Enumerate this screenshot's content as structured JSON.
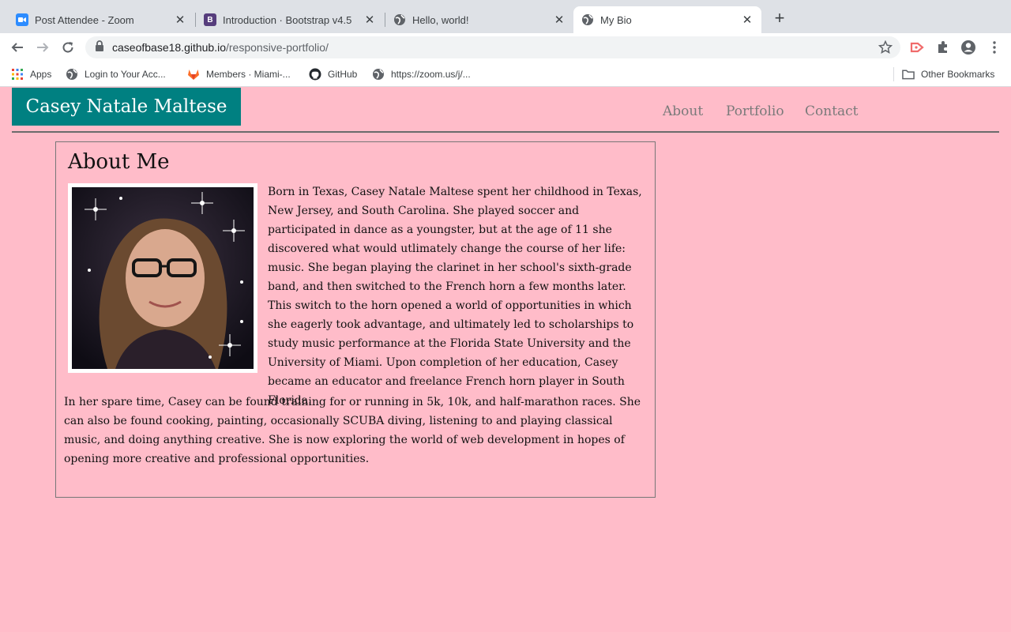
{
  "browser": {
    "tabs": [
      {
        "title": "Post Attendee - Zoom",
        "icon": "zoom-icon",
        "active": false
      },
      {
        "title": "Introduction · Bootstrap v4.5",
        "icon": "bootstrap-icon",
        "active": false
      },
      {
        "title": "Hello, world!",
        "icon": "globe-icon",
        "active": false
      },
      {
        "title": "My Bio",
        "icon": "globe-icon",
        "active": true
      }
    ],
    "new_tab_label": "+",
    "close_label": "✕",
    "url_host": "caseofbase18.github.io",
    "url_path": "/responsive-portfolio/",
    "bookmarks": [
      {
        "label": "Apps",
        "icon": "apps-grid-icon"
      },
      {
        "label": "Login to Your Acc...",
        "icon": "globe-icon"
      },
      {
        "label": "Members · Miami-...",
        "icon": "gitlab-icon"
      },
      {
        "label": "GitHub",
        "icon": "github-icon"
      },
      {
        "label": "https://zoom.us/j/...",
        "icon": "globe-icon"
      }
    ],
    "other_bookmarks": "Other Bookmarks"
  },
  "site": {
    "brand": "Casey Natale Maltese",
    "nav": [
      "About",
      "Portfolio",
      "Contact"
    ],
    "about": {
      "heading": "About Me",
      "paragraph1": "Born in Texas, Casey Natale Maltese spent her childhood in Texas, New Jersey, and South Carolina. She played soccer and participated in dance as a youngster, but at the age of 11 she discovered what would utlimately change the course of her life: music. She began playing the clarinet in her school's sixth-grade band, and then switched to the French horn a few months later. This switch to the horn opened a world of opportunities in which she eagerly took advantage, and ultimately led to scholarships to study music performance at the Florida State University and the University of Miami. Upon completion of her education, Casey became an educator and freelance French horn player in South Florida.",
      "paragraph2": "In her spare time, Casey can be found training for or running in 5k, 10k, and half-marathon races. She can also be found cooking, painting, occasionally SCUBA diving, listening to and playing classical music, and doing anything creative. She is now exploring the world of web development in hopes of opening more creative and professional opportunities."
    }
  },
  "colors": {
    "page_bg": "#ffbcc9",
    "brand_bg": "#008081",
    "nav_text": "#7a7a7a"
  }
}
